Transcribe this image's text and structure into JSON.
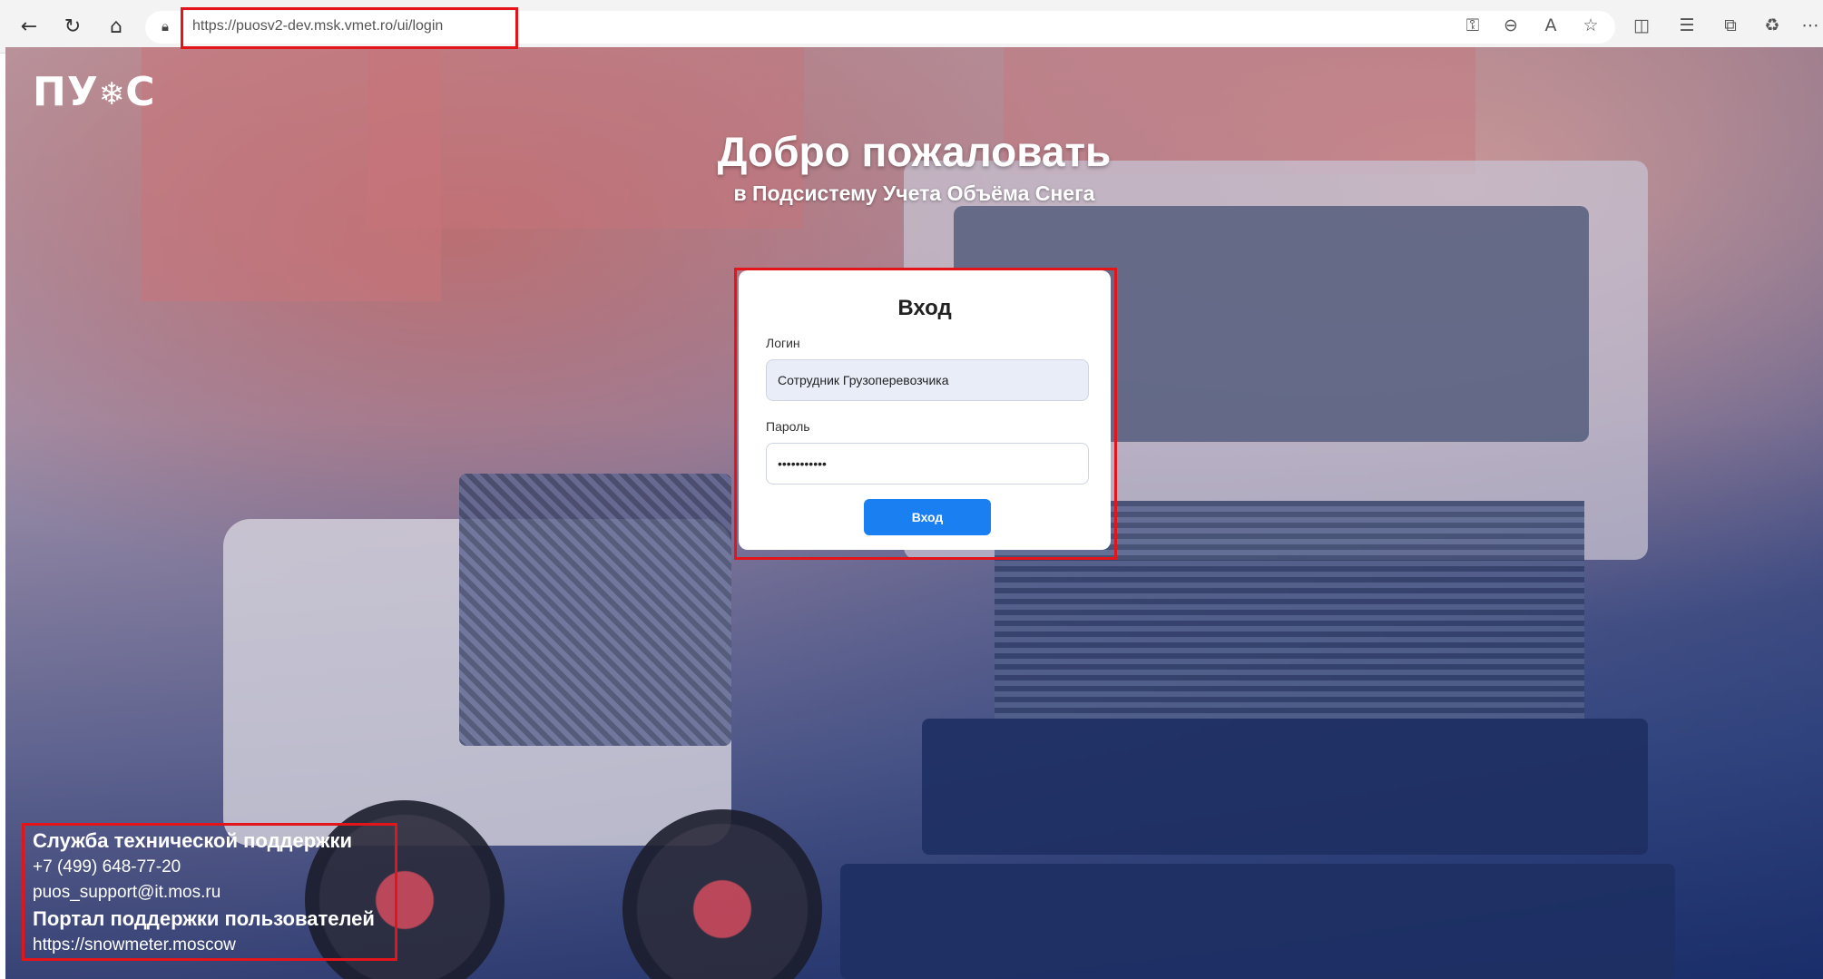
{
  "browser": {
    "url": "https://puosv2-dev.msk.vmet.ro/ui/login",
    "nav_icons": [
      "back-arrow-icon",
      "reload-icon",
      "home-icon"
    ],
    "right_icons": [
      "key-icon",
      "zoom-out-icon",
      "read-aloud-icon",
      "favorite-star-icon",
      "split-screen-icon",
      "favorites-list-icon",
      "collections-icon",
      "extension-icon",
      "more-icon"
    ]
  },
  "page": {
    "logo": {
      "text_left": "ПУ",
      "text_right": "С",
      "snow_glyph": "❄"
    },
    "welcome_title": "Добро пожаловать",
    "welcome_subtitle": "в Подсистему Учета Объёма Снега"
  },
  "login_form": {
    "title": "Вход",
    "login_label": "Логин",
    "login_value": "Сотрудник Грузоперевозчика",
    "password_label": "Пароль",
    "password_value": "•••••••••••",
    "submit_label": "Вход"
  },
  "support": {
    "heading": "Служба технической поддержки",
    "phone": "+7 (499) 648-77-20",
    "email": "puos_support@it.mos.ru",
    "portal_heading": "Портал поддержки пользователей",
    "portal_url": "https://snowmeter.moscow"
  },
  "colors": {
    "highlight": "#e4141b",
    "button": "#1a7ff0"
  }
}
